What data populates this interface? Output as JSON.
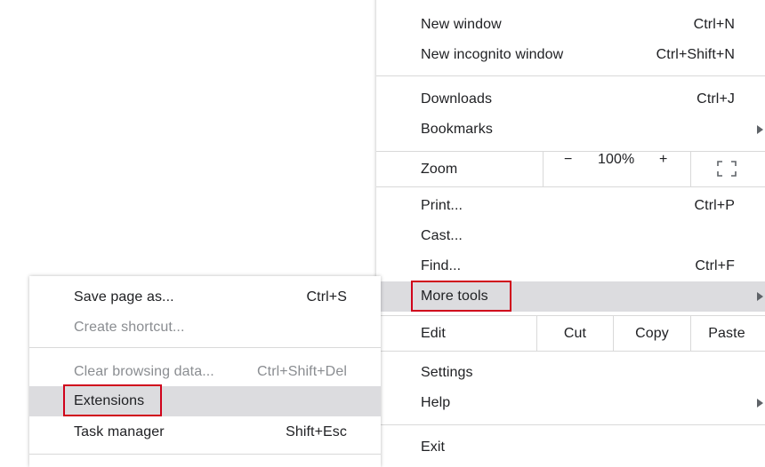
{
  "main_menu": {
    "new_window": {
      "label": "New window",
      "shortcut": "Ctrl+N"
    },
    "new_incognito": {
      "label": "New incognito window",
      "shortcut": "Ctrl+Shift+N"
    },
    "downloads": {
      "label": "Downloads",
      "shortcut": "Ctrl+J"
    },
    "bookmarks": {
      "label": "Bookmarks"
    },
    "zoom": {
      "label": "Zoom",
      "minus": "−",
      "level": "100%",
      "plus": "+",
      "fullscreen_icon": "fullscreen-icon"
    },
    "print": {
      "label": "Print...",
      "shortcut": "Ctrl+P"
    },
    "cast": {
      "label": "Cast..."
    },
    "find": {
      "label": "Find...",
      "shortcut": "Ctrl+F"
    },
    "more_tools": {
      "label": "More tools"
    },
    "edit": {
      "label": "Edit",
      "cut": "Cut",
      "copy": "Copy",
      "paste": "Paste"
    },
    "settings": {
      "label": "Settings"
    },
    "help": {
      "label": "Help"
    },
    "exit": {
      "label": "Exit"
    }
  },
  "submenu": {
    "save_page": {
      "label": "Save page as...",
      "shortcut": "Ctrl+S"
    },
    "create_shortcut": {
      "label": "Create shortcut..."
    },
    "clear_data": {
      "label": "Clear browsing data...",
      "shortcut": "Ctrl+Shift+Del"
    },
    "extensions": {
      "label": "Extensions"
    },
    "task_manager": {
      "label": "Task manager",
      "shortcut": "Shift+Esc"
    }
  },
  "colors": {
    "highlight": "#dcdcdf",
    "annotation_red": "#d0021b",
    "disabled_text": "#8a8d91"
  }
}
